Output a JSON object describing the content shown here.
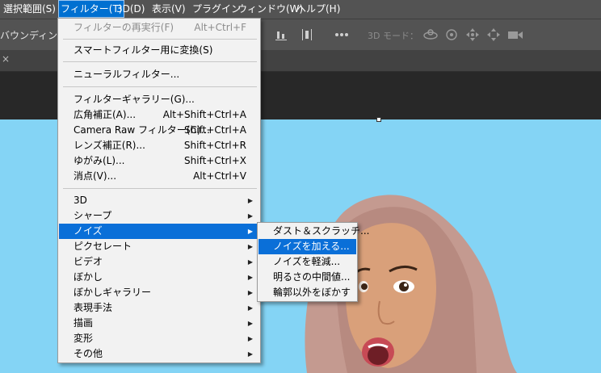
{
  "menubar": {
    "items": [
      "選択範囲(S)",
      "フィルター(T)",
      "3D(D)",
      "表示(V)",
      "プラグイン",
      "ウィンドウ(W)",
      "ヘルプ(H)"
    ]
  },
  "options_bar": {
    "label": "バウンディングボ",
    "mode_label": "3D モード："
  },
  "filter_menu": {
    "last_filter": {
      "label": "フィルターの再実行(F)",
      "shortcut": "Alt+Ctrl+F"
    },
    "smart_filter": "スマートフィルター用に変換(S)",
    "neural_filter": "ニューラルフィルター...",
    "group2": [
      {
        "label": "フィルターギャラリー(G)...",
        "shortcut": ""
      },
      {
        "label": "広角補正(A)...",
        "shortcut": "Alt+Shift+Ctrl+A"
      },
      {
        "label": "Camera Raw フィルター(C)...",
        "shortcut": "Shift+Ctrl+A"
      },
      {
        "label": "レンズ補正(R)...",
        "shortcut": "Shift+Ctrl+R"
      },
      {
        "label": "ゆがみ(L)...",
        "shortcut": "Shift+Ctrl+X"
      },
      {
        "label": "消点(V)...",
        "shortcut": "Alt+Ctrl+V"
      }
    ],
    "submenus": [
      "3D",
      "シャープ",
      "ノイズ",
      "ピクセレート",
      "ビデオ",
      "ぼかし",
      "ぼかしギャラリー",
      "表現手法",
      "描画",
      "変形",
      "その他"
    ]
  },
  "noise_menu": {
    "items": [
      "ダスト＆スクラッチ...",
      "ノイズを加える...",
      "ノイズを軽減...",
      "明るさの中間値...",
      "輪郭以外をぼかす"
    ]
  },
  "colors": {
    "highlight": "#0a6fd8",
    "canvas_sky": "#84d4f5"
  }
}
